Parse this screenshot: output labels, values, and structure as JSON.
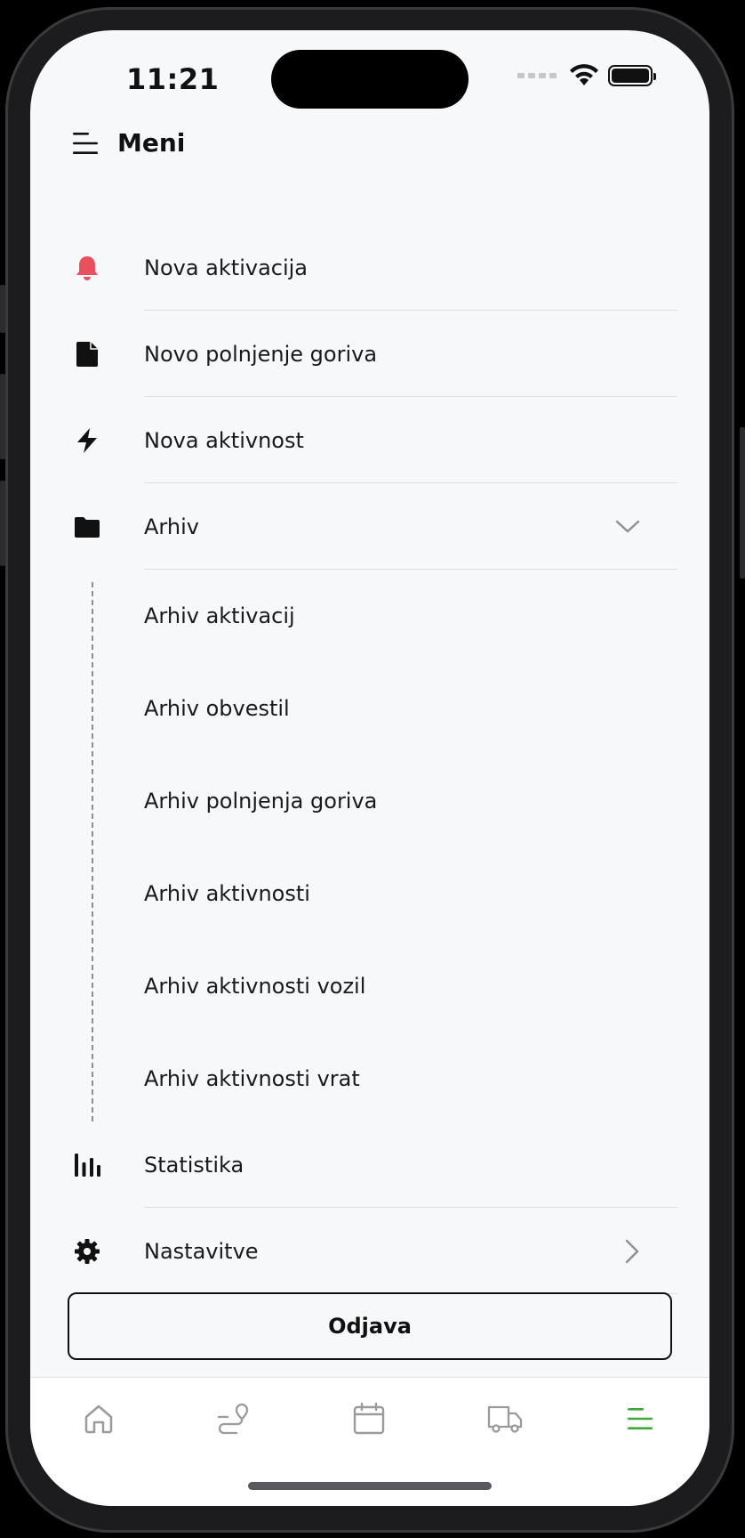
{
  "status_bar": {
    "time": "11:21"
  },
  "header": {
    "title": "Meni"
  },
  "menu": {
    "items": [
      {
        "label": "Nova aktivacija",
        "icon": "bell-icon",
        "color": "#e8505b"
      },
      {
        "label": "Novo polnjenje goriva",
        "icon": "fuel-document-icon"
      },
      {
        "label": "Nova aktivnost",
        "icon": "lightning-icon"
      },
      {
        "label": "Arhiv",
        "icon": "folder-icon",
        "expanded": true
      }
    ],
    "submenu": [
      {
        "label": "Arhiv aktivacij"
      },
      {
        "label": "Arhiv obvestil"
      },
      {
        "label": "Arhiv polnjenja goriva"
      },
      {
        "label": "Arhiv aktivnosti"
      },
      {
        "label": "Arhiv aktivnosti vozil"
      },
      {
        "label": "Arhiv aktivnosti vrat"
      }
    ],
    "bottom_items": [
      {
        "label": "Statistika",
        "icon": "bar-chart-icon"
      },
      {
        "label": "Nastavitve",
        "icon": "gear-icon"
      }
    ]
  },
  "logout": {
    "label": "Odjava"
  },
  "tabbar": {
    "tabs": [
      {
        "icon": "home-icon",
        "active": false
      },
      {
        "icon": "route-icon",
        "active": false
      },
      {
        "icon": "calendar-icon",
        "active": false
      },
      {
        "icon": "truck-icon",
        "active": false
      },
      {
        "icon": "menu-icon",
        "active": true
      }
    ],
    "active_color": "#3aaa35",
    "inactive_color": "#9a9a9f"
  }
}
